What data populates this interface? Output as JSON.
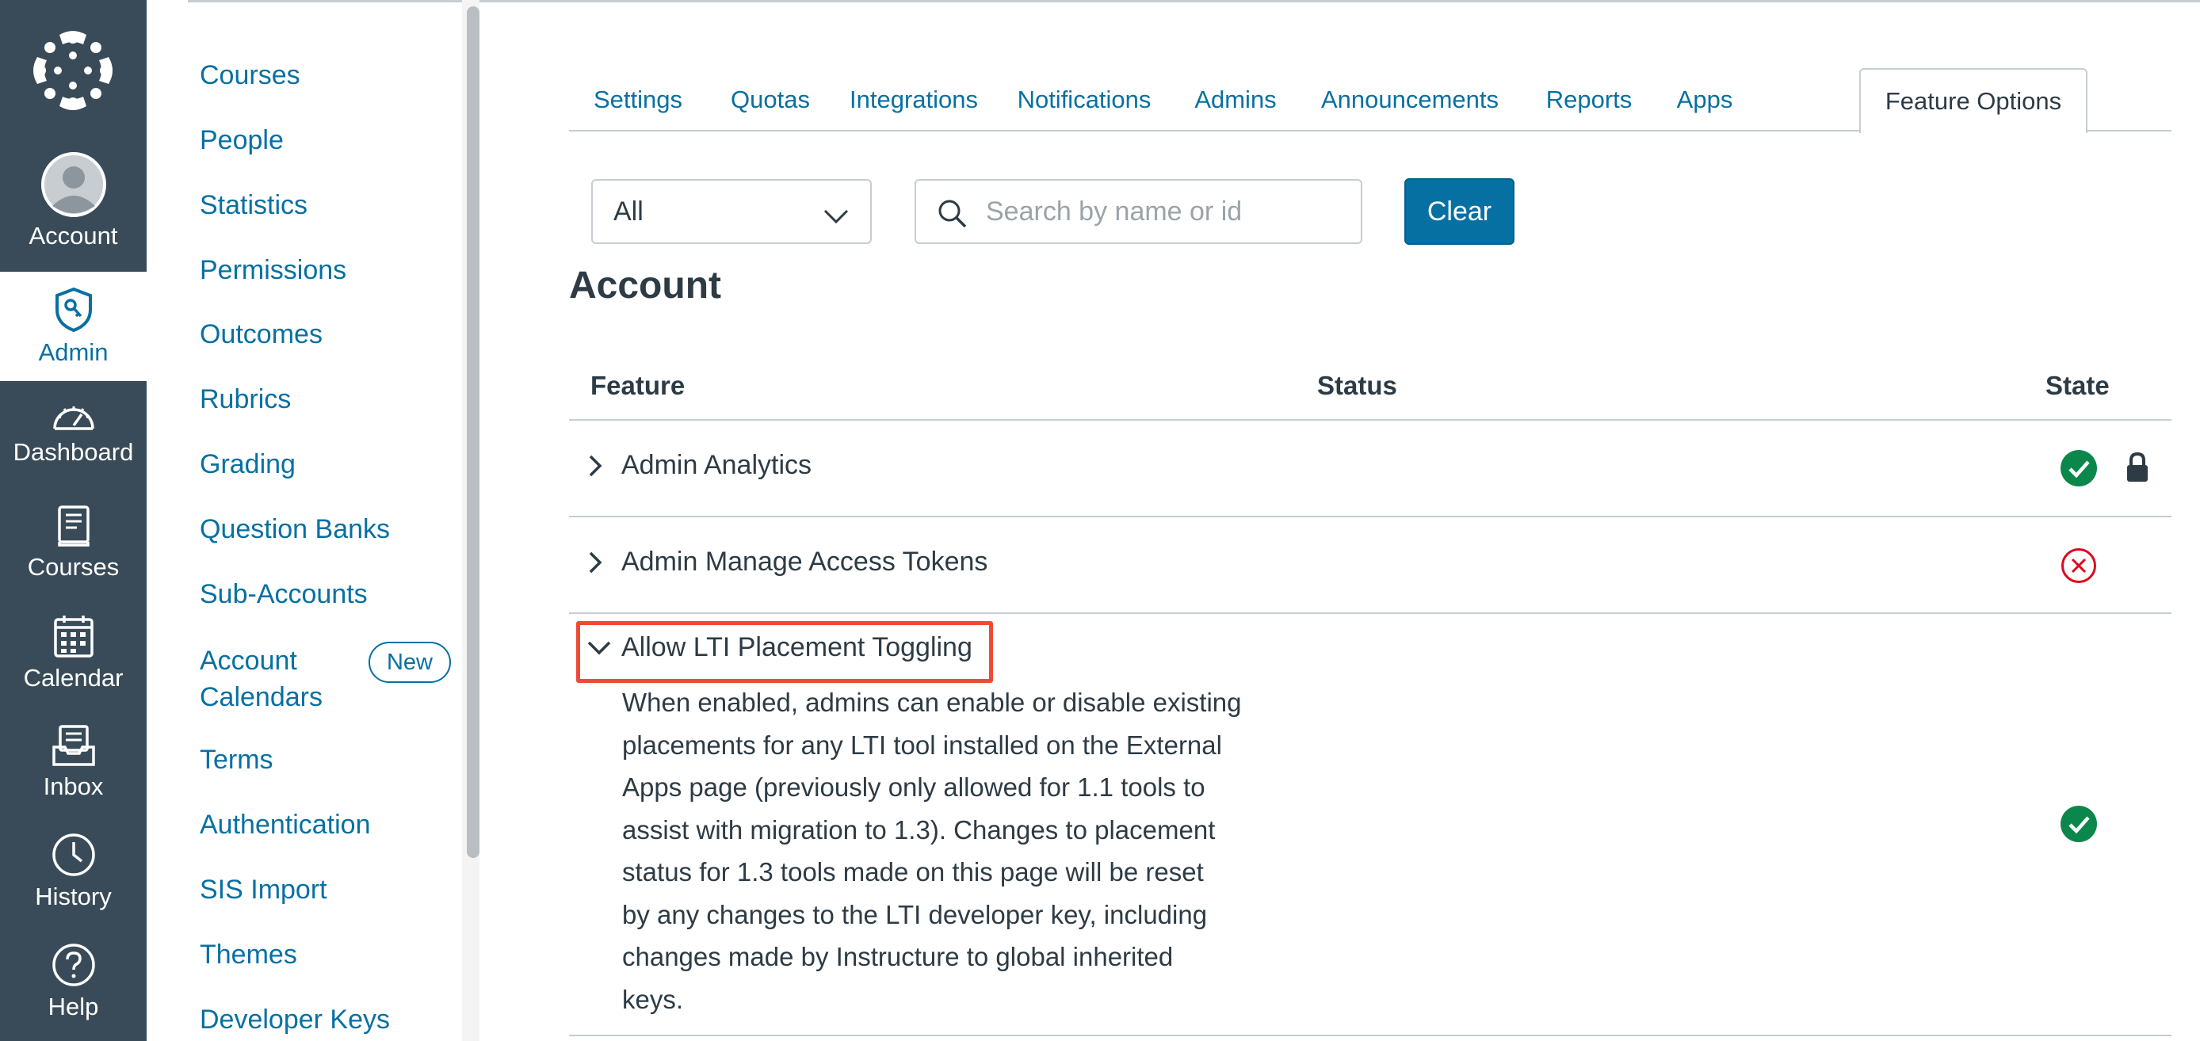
{
  "global_nav": {
    "items": [
      {
        "label": "Account",
        "icon": "avatar-icon"
      },
      {
        "label": "Admin",
        "icon": "admin-shield-icon",
        "active": true
      },
      {
        "label": "Dashboard",
        "icon": "dashboard-gauge-icon"
      },
      {
        "label": "Courses",
        "icon": "book-icon"
      },
      {
        "label": "Calendar",
        "icon": "calendar-icon"
      },
      {
        "label": "Inbox",
        "icon": "inbox-icon"
      },
      {
        "label": "History",
        "icon": "clock-icon"
      },
      {
        "label": "Help",
        "icon": "help-icon"
      }
    ]
  },
  "sub_nav": {
    "items": [
      {
        "label": "Courses"
      },
      {
        "label": "People"
      },
      {
        "label": "Statistics"
      },
      {
        "label": "Permissions"
      },
      {
        "label": "Outcomes"
      },
      {
        "label": "Rubrics"
      },
      {
        "label": "Grading"
      },
      {
        "label": "Question Banks"
      },
      {
        "label": "Sub-Accounts"
      },
      {
        "label": "Account Calendars",
        "badge": "New"
      },
      {
        "label": "Terms"
      },
      {
        "label": "Authentication"
      },
      {
        "label": "SIS Import"
      },
      {
        "label": "Themes"
      },
      {
        "label": "Developer Keys"
      }
    ]
  },
  "tabs": [
    {
      "label": "Settings"
    },
    {
      "label": "Quotas"
    },
    {
      "label": "Integrations"
    },
    {
      "label": "Notifications"
    },
    {
      "label": "Admins"
    },
    {
      "label": "Announcements"
    },
    {
      "label": "Reports"
    },
    {
      "label": "Apps"
    },
    {
      "label": "Feature Options",
      "active": true
    }
  ],
  "filter": {
    "selected": "All"
  },
  "search": {
    "placeholder": "Search by name or id",
    "value": ""
  },
  "clear_label": "Clear",
  "section_title": "Account",
  "table": {
    "headers": {
      "feature": "Feature",
      "status": "Status",
      "state": "State"
    },
    "rows": [
      {
        "name": "Admin Analytics",
        "expanded": false,
        "state": "enabled",
        "locked": true
      },
      {
        "name": "Admin Manage Access Tokens",
        "expanded": false,
        "state": "disabled",
        "locked": false
      },
      {
        "name": "Allow LTI Placement Toggling",
        "expanded": true,
        "state": "enabled",
        "locked": false,
        "description_lines": [
          "When enabled, admins can enable or disable existing",
          "placements for any LTI tool installed on the External",
          "Apps page (previously only allowed for 1.1 tools to",
          "assist with migration to 1.3). Changes to placement",
          "status for 1.3 tools made on this page will be reset",
          "by any changes to the LTI developer key, including",
          "changes made by Instructure to global inherited",
          "keys."
        ]
      }
    ]
  },
  "colors": {
    "nav_bg": "#394b58",
    "link": "#0770a3",
    "enabled": "#0b874b",
    "disabled": "#e0061f",
    "highlight": "#ee4b36"
  }
}
